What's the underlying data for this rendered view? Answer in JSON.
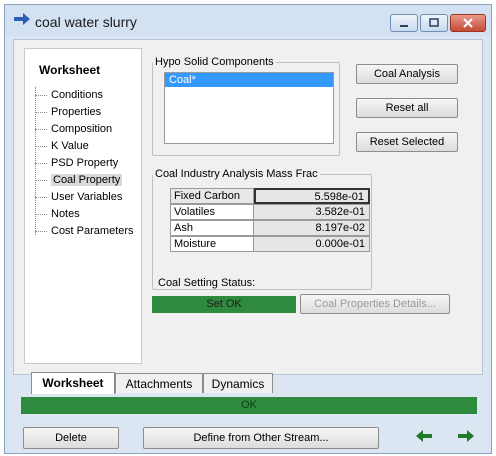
{
  "window": {
    "title": "coal water slurry",
    "title_icon": "right-arrow-icon"
  },
  "tree": {
    "title": "Worksheet",
    "items": [
      {
        "label": "Conditions"
      },
      {
        "label": "Properties"
      },
      {
        "label": "Composition"
      },
      {
        "label": "K Value"
      },
      {
        "label": "PSD Property"
      },
      {
        "label": "Coal Property",
        "selected": true
      },
      {
        "label": "User Variables"
      },
      {
        "label": "Notes"
      },
      {
        "label": "Cost Parameters"
      }
    ]
  },
  "hypo": {
    "group_label": "Hypo Solid Components",
    "components": [
      "Coal*"
    ],
    "selected": "Coal*"
  },
  "buttons": {
    "coal_analysis": "Coal Analysis",
    "reset_all": "Reset all",
    "reset_selected": "Reset Selected",
    "coal_details": "Coal Properties Details...",
    "delete": "Delete",
    "define_from_other": "Define from Other Stream..."
  },
  "coal_analysis": {
    "group_label": "Coal Industry Analysis Mass Frac",
    "rows": [
      {
        "name": "Fixed Carbon",
        "value": "5.598e-01"
      },
      {
        "name": "Volatiles",
        "value": "3.582e-01"
      },
      {
        "name": "Ash",
        "value": "8.197e-02"
      },
      {
        "name": "Moisture",
        "value": "0.000e-01"
      }
    ]
  },
  "status": {
    "label": "Coal Setting Status:",
    "value": "Set OK",
    "ok_bar": "OK",
    "color_ok": "#2e8b3e"
  },
  "tabs": [
    "Worksheet",
    "Attachments",
    "Dynamics"
  ],
  "active_tab": "Worksheet",
  "nav": {
    "prev_icon": "left-arrow-icon",
    "next_icon": "right-arrow-icon"
  }
}
